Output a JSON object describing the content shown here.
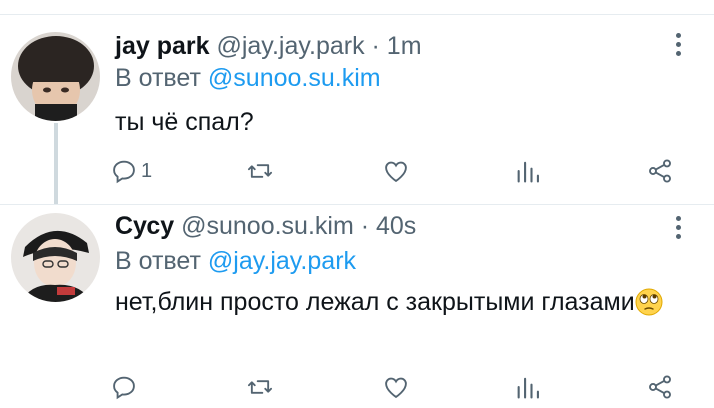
{
  "tweets": [
    {
      "name": "jay park",
      "handle": "@jay.jay.park",
      "sep": " · ",
      "time": "1m",
      "reply_prefix": "В ответ ",
      "reply_to": "@sunoo.su.kim",
      "text": "ты чё спал?",
      "text_emoji": "",
      "reply_count": "1",
      "icons": [
        "reply-icon",
        "retweet-icon",
        "like-icon",
        "analytics-icon",
        "share-icon",
        "more-icon"
      ]
    },
    {
      "name": "Сусу",
      "handle": "@sunoo.su.kim",
      "sep": " · ",
      "time": "40s",
      "reply_prefix": "В ответ ",
      "reply_to": "@jay.jay.park",
      "text": "нет,блин просто лежал с закрытыми глазами",
      "text_emoji": "🙄",
      "reply_count": "",
      "icons": [
        "reply-icon",
        "retweet-icon",
        "like-icon",
        "analytics-icon",
        "share-icon",
        "more-icon"
      ]
    }
  ],
  "colors": {
    "link": "#1d9bf0",
    "secondary_text": "#536471",
    "primary_text": "#0f1419",
    "divider": "#e6ecf0"
  }
}
